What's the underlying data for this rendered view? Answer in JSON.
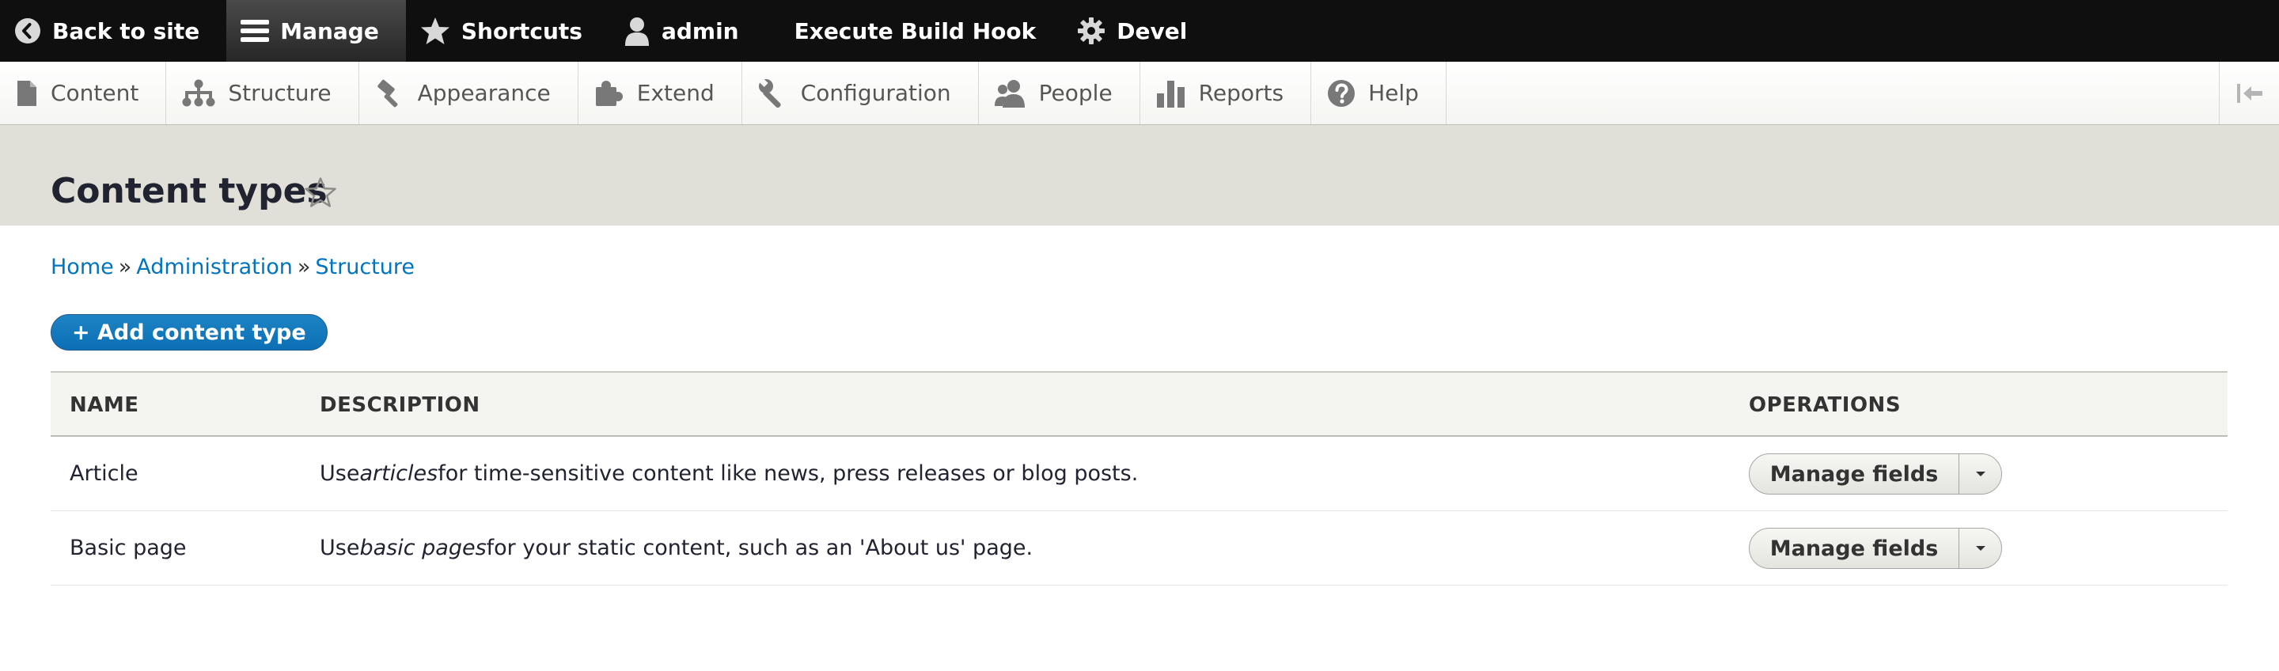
{
  "toolbar": {
    "items": [
      {
        "label": "Back to site",
        "icon": "back-circle-icon"
      },
      {
        "label": "Manage",
        "icon": "hamburger-icon",
        "active": true
      },
      {
        "label": "Shortcuts",
        "icon": "star-filled-icon"
      },
      {
        "label": "admin",
        "icon": "user-icon"
      },
      {
        "label": "Execute Build Hook",
        "icon": ""
      },
      {
        "label": "Devel",
        "icon": "gear-icon"
      }
    ]
  },
  "tray": {
    "items": [
      {
        "label": "Content",
        "icon": "file-icon"
      },
      {
        "label": "Structure",
        "icon": "sitemap-icon"
      },
      {
        "label": "Appearance",
        "icon": "paintbrush-icon"
      },
      {
        "label": "Extend",
        "icon": "puzzle-icon"
      },
      {
        "label": "Configuration",
        "icon": "wrench-icon"
      },
      {
        "label": "People",
        "icon": "people-icon"
      },
      {
        "label": "Reports",
        "icon": "bar-chart-icon"
      },
      {
        "label": "Help",
        "icon": "question-icon"
      }
    ],
    "toggle_icon": "collapse-sidebar-icon"
  },
  "page": {
    "title": "Content types",
    "shortcut_icon": "star-outline-icon"
  },
  "breadcrumb": {
    "items": [
      "Home",
      "Administration",
      "Structure"
    ],
    "separator": "»"
  },
  "actions": {
    "add_label": "+ Add content type"
  },
  "table": {
    "headers": {
      "name": "NAME",
      "description": "DESCRIPTION",
      "operations": "OPERATIONS"
    },
    "rows": [
      {
        "name": "Article",
        "desc_before": "Use ",
        "desc_em": "articles",
        "desc_after": " for time-sensitive content like news, press releases or blog posts.",
        "operation": "Manage fields"
      },
      {
        "name": "Basic page",
        "desc_before": "Use ",
        "desc_em": "basic pages",
        "desc_after": " for your static content, such as an 'About us' page.",
        "operation": "Manage fields"
      }
    ]
  },
  "colors": {
    "toolbar_bg": "#0f0f0f",
    "header_bg": "#e0e0d8",
    "link": "#0074bd",
    "primary_button": "#1d84c3"
  }
}
